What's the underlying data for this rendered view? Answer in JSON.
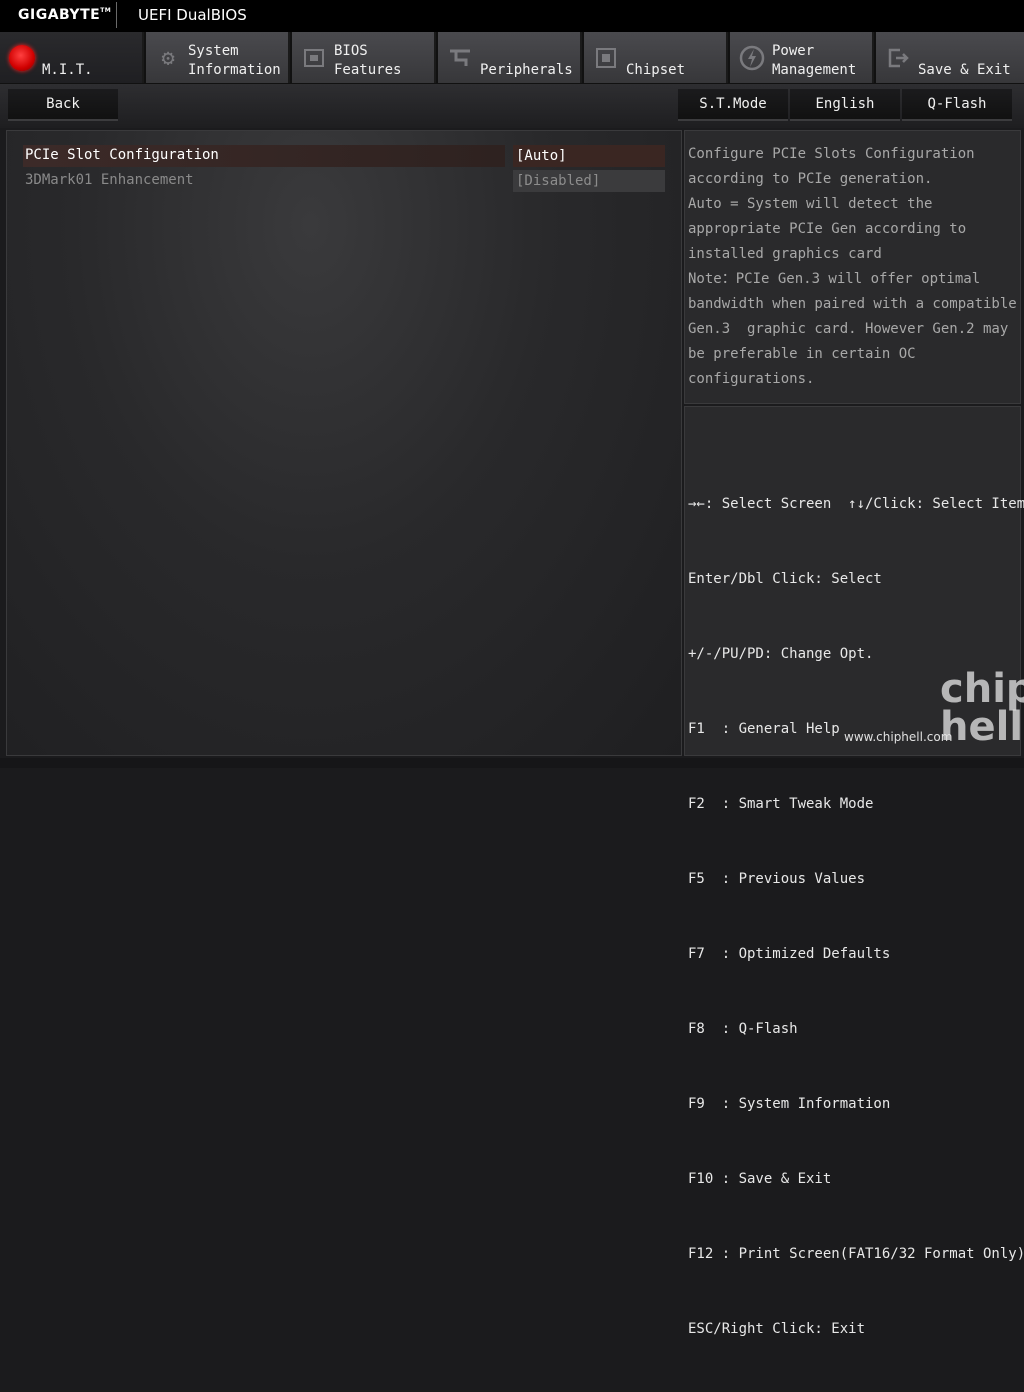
{
  "header": {
    "brand": "GIGABYTE",
    "brand_mark": "TM",
    "title": "UEFI DualBIOS"
  },
  "tabs": [
    {
      "label": "M.I.T.",
      "icon": "mit-icon",
      "active": true
    },
    {
      "label": "System\nInformation",
      "icon": "gear-icon",
      "active": false
    },
    {
      "label": "BIOS\nFeatures",
      "icon": "chip-icon",
      "active": false
    },
    {
      "label": "Peripherals",
      "icon": "plug-icon",
      "active": false
    },
    {
      "label": "Chipset",
      "icon": "chipset-icon",
      "active": false
    },
    {
      "label": "Power\nManagement",
      "icon": "power-icon",
      "active": false
    },
    {
      "label": "Save & Exit",
      "icon": "exit-icon",
      "active": false
    }
  ],
  "toolbar": {
    "back": "Back",
    "st_mode": "S.T.Mode",
    "language": "English",
    "qflash": "Q-Flash"
  },
  "settings": [
    {
      "name": "PCIe Slot Configuration",
      "value": "[Auto]",
      "state": "selected"
    },
    {
      "name": "3DMark01 Enhancement",
      "value": "[Disabled]",
      "state": "disabled"
    }
  ],
  "help": {
    "text": "Configure PCIe Slots Configuration\naccording to PCIe generation.\nAuto = System will detect the\nappropriate PCIe Gen according to\ninstalled graphics card\nNote：PCIe Gen.3 will offer optimal\nbandwidth when paired with a compatible\nGen.3  graphic card. However Gen.2 may\nbe preferable in certain OC\nconfigurations."
  },
  "keys": [
    "→←: Select Screen  ↑↓/Click: Select Item",
    "Enter/Dbl Click: Select",
    "+/-/PU/PD: Change Opt.",
    "F1  : General Help",
    "F2  : Smart Tweak Mode",
    "F5  : Previous Values",
    "F7  : Optimized Defaults",
    "F8  : Q-Flash",
    "F9  : System Information",
    "F10 : Save & Exit",
    "F12 : Print Screen(FAT16/32 Format Only)",
    "ESC/Right Click: Exit"
  ],
  "watermark": {
    "big": "chip\nhell",
    "url": "www.chiphell.com"
  }
}
